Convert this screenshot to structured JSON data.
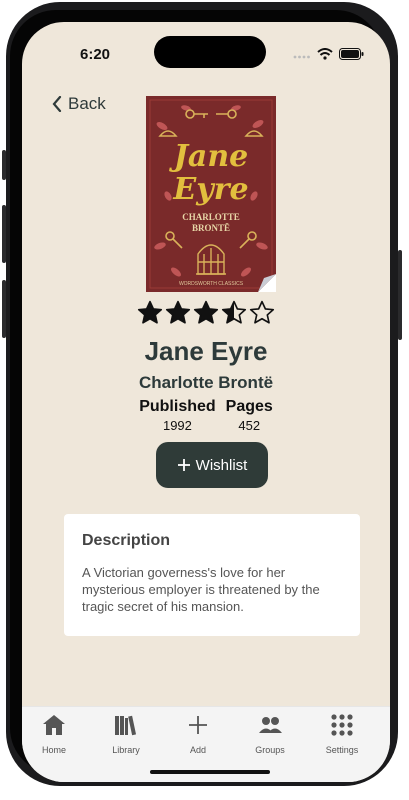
{
  "status_bar": {
    "time": "6:20"
  },
  "nav": {
    "back_label": "Back"
  },
  "book": {
    "cover": {
      "title_line1": "Jane",
      "title_line2": "Eyre",
      "author_line1": "CHARLOTTE",
      "author_line2": "BRONTË",
      "series": "WORDSWORTH CLASSICS",
      "colors": {
        "background": "#7a2a2a",
        "title": "#e2bf3e",
        "leaves": "#c75a5a"
      }
    },
    "rating": 3.5,
    "rating_max": 5,
    "title": "Jane Eyre",
    "author": "Charlotte Brontë",
    "published_label": "Published",
    "published_value": "1992",
    "pages_label": "Pages",
    "pages_value": "452"
  },
  "wishlist_button": {
    "label": "Wishlist",
    "icon": "plus-icon"
  },
  "description": {
    "heading": "Description",
    "text": "A Victorian governess's love for her mysterious employer is threatened by the tragic secret of his mansion."
  },
  "tab_bar": {
    "items": [
      {
        "label": "Home",
        "icon": "home-icon"
      },
      {
        "label": "Library",
        "icon": "library-icon"
      },
      {
        "label": "Add",
        "icon": "plus-icon"
      },
      {
        "label": "Groups",
        "icon": "groups-icon"
      },
      {
        "label": "Settings",
        "icon": "grid-icon"
      }
    ]
  },
  "colors": {
    "background": "#efe7da",
    "accent": "#2f3b38",
    "text": "#2d3a3a"
  }
}
